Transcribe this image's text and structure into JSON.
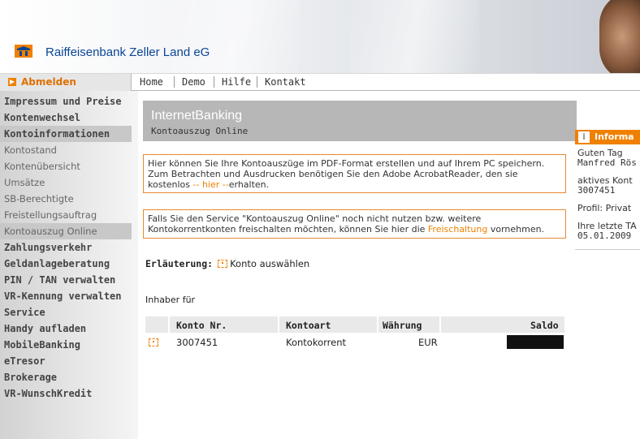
{
  "header": {
    "bank_name": "Raiffeisenbank Zeller Land eG",
    "logo_icon": "raiffeisen-logo-icon"
  },
  "topnav": {
    "logout_label": "Abmelden",
    "items": [
      "Home",
      "Demo",
      "Hilfe",
      "Kontakt"
    ]
  },
  "sidebar": {
    "items": [
      {
        "label": "Impressum und Preise",
        "kind": "main"
      },
      {
        "label": "Kontenwechsel",
        "kind": "main"
      },
      {
        "label": "Kontoinformationen",
        "kind": "main"
      },
      {
        "label": "Kontostand",
        "kind": "sub"
      },
      {
        "label": "Kontenübersicht",
        "kind": "sub"
      },
      {
        "label": "Umsätze",
        "kind": "sub"
      },
      {
        "label": "SB-Berechtigte",
        "kind": "sub"
      },
      {
        "label": "Freistellungsauftrag",
        "kind": "sub"
      },
      {
        "label": "Kontoauszug Online",
        "kind": "sub"
      },
      {
        "label": "Zahlungsverkehr",
        "kind": "main"
      },
      {
        "label": "Geldanlageberatung",
        "kind": "main"
      },
      {
        "label": "PIN / TAN verwalten",
        "kind": "main"
      },
      {
        "label": "VR-Kennung verwalten",
        "kind": "main"
      },
      {
        "label": "Service",
        "kind": "main"
      },
      {
        "label": "Handy aufladen",
        "kind": "main"
      },
      {
        "label": "MobileBanking",
        "kind": "main"
      },
      {
        "label": "eTresor",
        "kind": "main"
      },
      {
        "label": "Brokerage",
        "kind": "main"
      },
      {
        "label": "VR-WunschKredit",
        "kind": "main"
      }
    ]
  },
  "content": {
    "title": "InternetBanking",
    "subtitle": "Kontoauszug Online",
    "box1": {
      "line1": "Hier können Sie Ihre Kontoauszüge im PDF-Format erstellen und auf Ihrem PC speichern.",
      "line2": "Zum Betrachten und Ausdrucken benötigen Sie den Adobe AcrobatReader, den sie",
      "line3_pre": "kostenlos ",
      "line3_link": "-- hier --",
      "line3_post": "erhalten."
    },
    "box2": {
      "line1": "Falls Sie den Service \"Kontoauszug Online\" noch nicht nutzen bzw. weitere",
      "line2_pre": "Kontokorrentkonten freischalten möchten, können Sie hier die ",
      "line2_link": "Freischaltung",
      "line2_post": " vornehmen."
    },
    "explain_label": "Erläuterung:",
    "explain_text": "Konto auswählen",
    "inhaber": "Inhaber für",
    "table": {
      "headers": [
        "Konto Nr.",
        "Kontoart",
        "Währung",
        "Saldo"
      ],
      "rows": [
        {
          "konto": "3007451",
          "art": "Kontokorrent",
          "waehrung": "EUR"
        }
      ]
    }
  },
  "info": {
    "title": "Informa",
    "greeting": "Guten Tag",
    "name": "Manfred Rös",
    "account_label": "aktives Kont",
    "account": "3007451",
    "profile": "Profil: Privat",
    "last_label": "Ihre letzte TA",
    "last_date": "05.01.2009"
  }
}
